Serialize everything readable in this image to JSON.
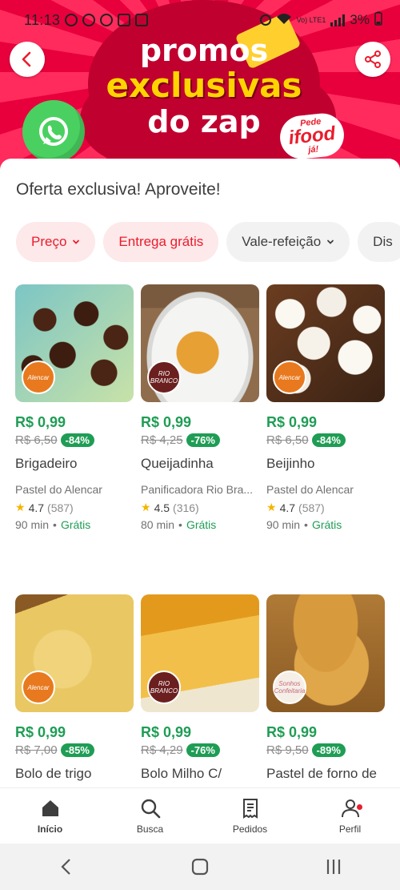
{
  "status_bar": {
    "time": "11:13",
    "battery": "3%",
    "network": "Vo) LTE1"
  },
  "banner": {
    "line1": "promos",
    "line2": "exclusivas",
    "line3": "do zap",
    "logo_top": "Pede",
    "logo_main": "ifood",
    "logo_bottom": "já!",
    "back_icon": "arrow-left-icon",
    "share_icon": "share-icon"
  },
  "sheet": {
    "title": "Oferta exclusiva! Aproveite!"
  },
  "filters": [
    {
      "label": "Preço",
      "has_dropdown": true,
      "active": true
    },
    {
      "label": "Entrega grátis",
      "has_dropdown": false,
      "active": true
    },
    {
      "label": "Vale-refeição",
      "has_dropdown": true,
      "active": false
    },
    {
      "label": "Dis",
      "has_dropdown": false,
      "active": false
    }
  ],
  "products": [
    {
      "price": "R$ 0,99",
      "old_price": "R$ 6,50",
      "discount": "-84%",
      "name": "Brigadeiro",
      "store": "Pastel do Alencar",
      "rating": "4.7",
      "rating_count": "(587)",
      "eta": "90 min",
      "delivery": "Grátis",
      "badge_text": "Alencar"
    },
    {
      "price": "R$ 0,99",
      "old_price": "R$ 4,25",
      "discount": "-76%",
      "name": "Queijadinha",
      "store": "Panificadora Rio Bra...",
      "rating": "4.5",
      "rating_count": "(316)",
      "eta": "80 min",
      "delivery": "Grátis",
      "badge_text": "RIO BRANCO"
    },
    {
      "price": "R$ 0,99",
      "old_price": "R$ 6,50",
      "discount": "-84%",
      "name": "Beijinho",
      "store": "Pastel do Alencar",
      "rating": "4.7",
      "rating_count": "(587)",
      "eta": "90 min",
      "delivery": "Grátis",
      "badge_text": "Alencar"
    },
    {
      "price": "R$ 0,99",
      "old_price": "R$ 7,00",
      "discount": "-85%",
      "name": "Bolo de trigo",
      "badge_text": "Alencar"
    },
    {
      "price": "R$ 0,99",
      "old_price": "R$ 4,29",
      "discount": "-76%",
      "name": "Bolo Milho C/",
      "badge_text": "RIO BRANCO"
    },
    {
      "price": "R$ 0,99",
      "old_price": "R$ 9,50",
      "discount": "-89%",
      "name": "Pastel de forno de",
      "badge_text": "Sonhos Confeitaria"
    }
  ],
  "bottom_nav": [
    {
      "label": "Início",
      "icon": "home-icon",
      "active": true
    },
    {
      "label": "Busca",
      "icon": "search-icon",
      "active": false
    },
    {
      "label": "Pedidos",
      "icon": "orders-icon",
      "active": false
    },
    {
      "label": "Perfil",
      "icon": "profile-icon",
      "active": false,
      "notification": true
    }
  ],
  "colors": {
    "brand_red": "#ea1d2c",
    "green": "#1f9d55",
    "chip_active_bg": "#fde8ea"
  }
}
